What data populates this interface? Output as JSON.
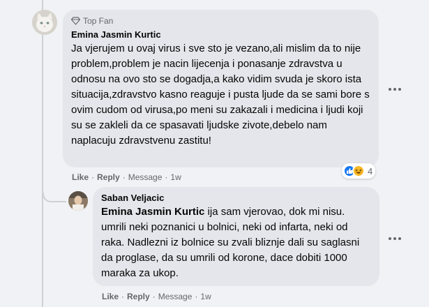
{
  "comment": {
    "badge": "Top Fan",
    "author": "Emina Jasmin Kurtic",
    "text": "Ja vjerujem u ovaj virus i sve sto je vezano,ali mislim da to nije problem,problem je nacin lijecenja i ponasanje zdravstva u odnosu na ovo sto se dogadja,a kako vidim svuda je skoro ista situacija,zdravstvo kasno reaguje i pusta ljude da se sami bore s ovim cudom od virusa,po meni su zakazali i medicina i ljudi koji su se zakleli da ce spasavati ljudske zivote,debelo nam naplacuju zdravstvenu zastitu!",
    "actions": {
      "like": "Like",
      "reply": "Reply",
      "message": "Message",
      "time": "1w"
    },
    "reactions": {
      "count": "4",
      "icons": [
        "like-icon",
        "haha-icon"
      ]
    }
  },
  "reply": {
    "author": "Saban Veljacic",
    "mention": "Emina Jasmin Kurtic",
    "text": " ija sam vjerovao, dok mi nisu. umrili neki poznanici u bolnici, neki od infarta, neki od raka. Nadlezni iz bolnice su zvali bliznje dali su saglasni da proglase, da su umrili od korone, dace dobiti 1000 maraka za ukop.",
    "actions": {
      "like": "Like",
      "reply": "Reply",
      "message": "Message",
      "time": "1w"
    }
  },
  "colors": {
    "bubble": "#e4e6eb",
    "background": "#f0f2f5",
    "secondary_text": "#65676b",
    "like_blue": "#1877f2",
    "haha_yellow": "#f7b928"
  }
}
